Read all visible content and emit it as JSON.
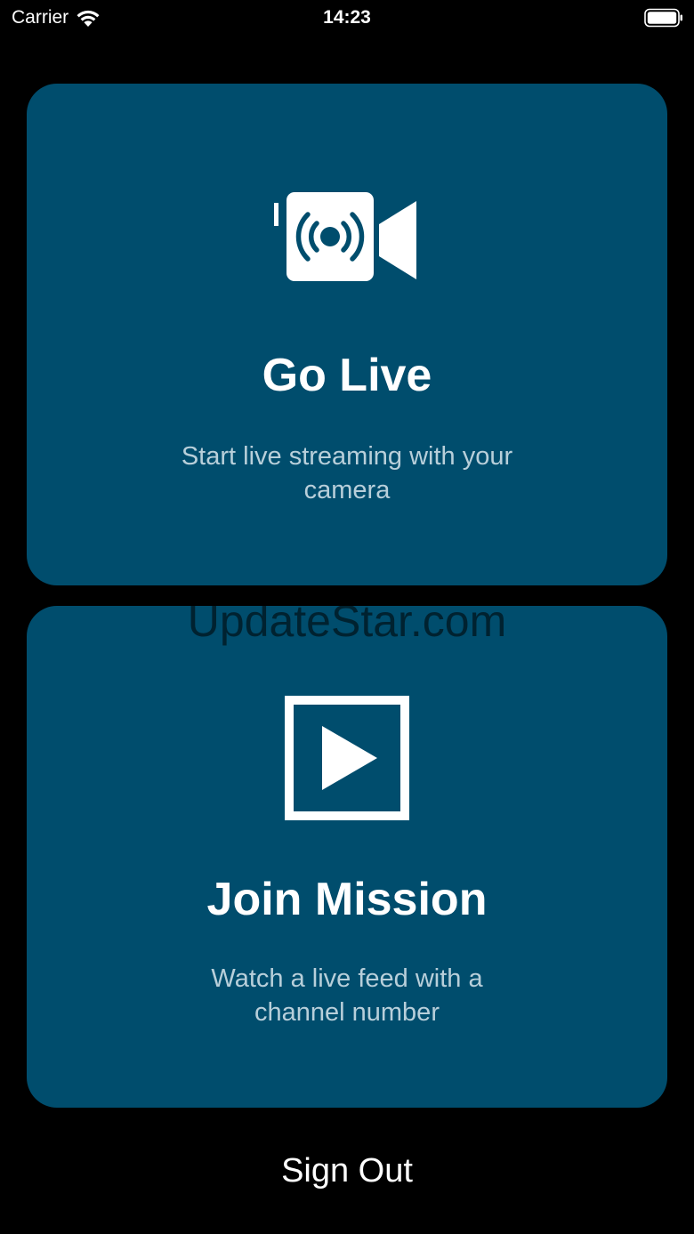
{
  "status_bar": {
    "carrier": "Carrier",
    "time": "14:23",
    "icons": [
      "wifi-icon",
      "battery-icon"
    ]
  },
  "cards": {
    "go_live": {
      "icon": "live-camera-icon",
      "title": "Go Live",
      "subtitle": "Start live streaming with your camera"
    },
    "join_mission": {
      "icon": "play-icon",
      "title": "Join Mission",
      "subtitle": "Watch a live feed with a channel number"
    }
  },
  "watermark": "UpdateStar.com",
  "sign_out_label": "Sign Out",
  "colors": {
    "background": "#000000",
    "card": "#004d6d",
    "text": "#ffffff",
    "subtitle": "#b8cfda"
  }
}
